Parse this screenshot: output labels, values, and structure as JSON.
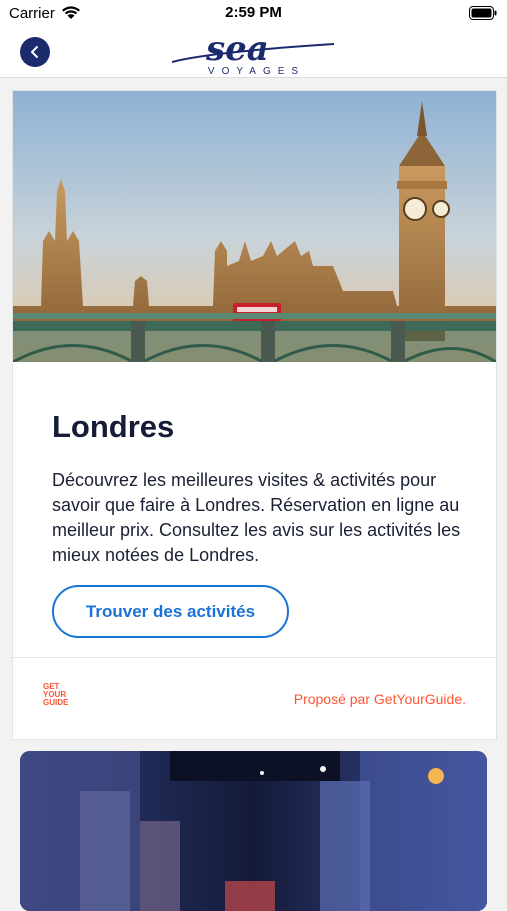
{
  "status_bar": {
    "carrier": "Carrier",
    "time": "2:59 PM"
  },
  "nav": {
    "brand_name": "sea",
    "brand_tagline": "VOYAGES",
    "brand_color": "#1c2b6e"
  },
  "card": {
    "title": "Londres",
    "description": "Découvrez les meilleures visites & activités pour savoir que faire à Londres. Réservation en ligne au meilleur prix. Consultez les avis sur les activités les mieux notées de Londres.",
    "cta_label": "Trouver des activités",
    "cta_color": "#1a73d6",
    "provider_logo_lines": [
      "GET",
      "YOUR",
      "GUIDE"
    ],
    "provided_by": "Proposé par GetYourGuide.",
    "provider_color": "#ff5533"
  }
}
